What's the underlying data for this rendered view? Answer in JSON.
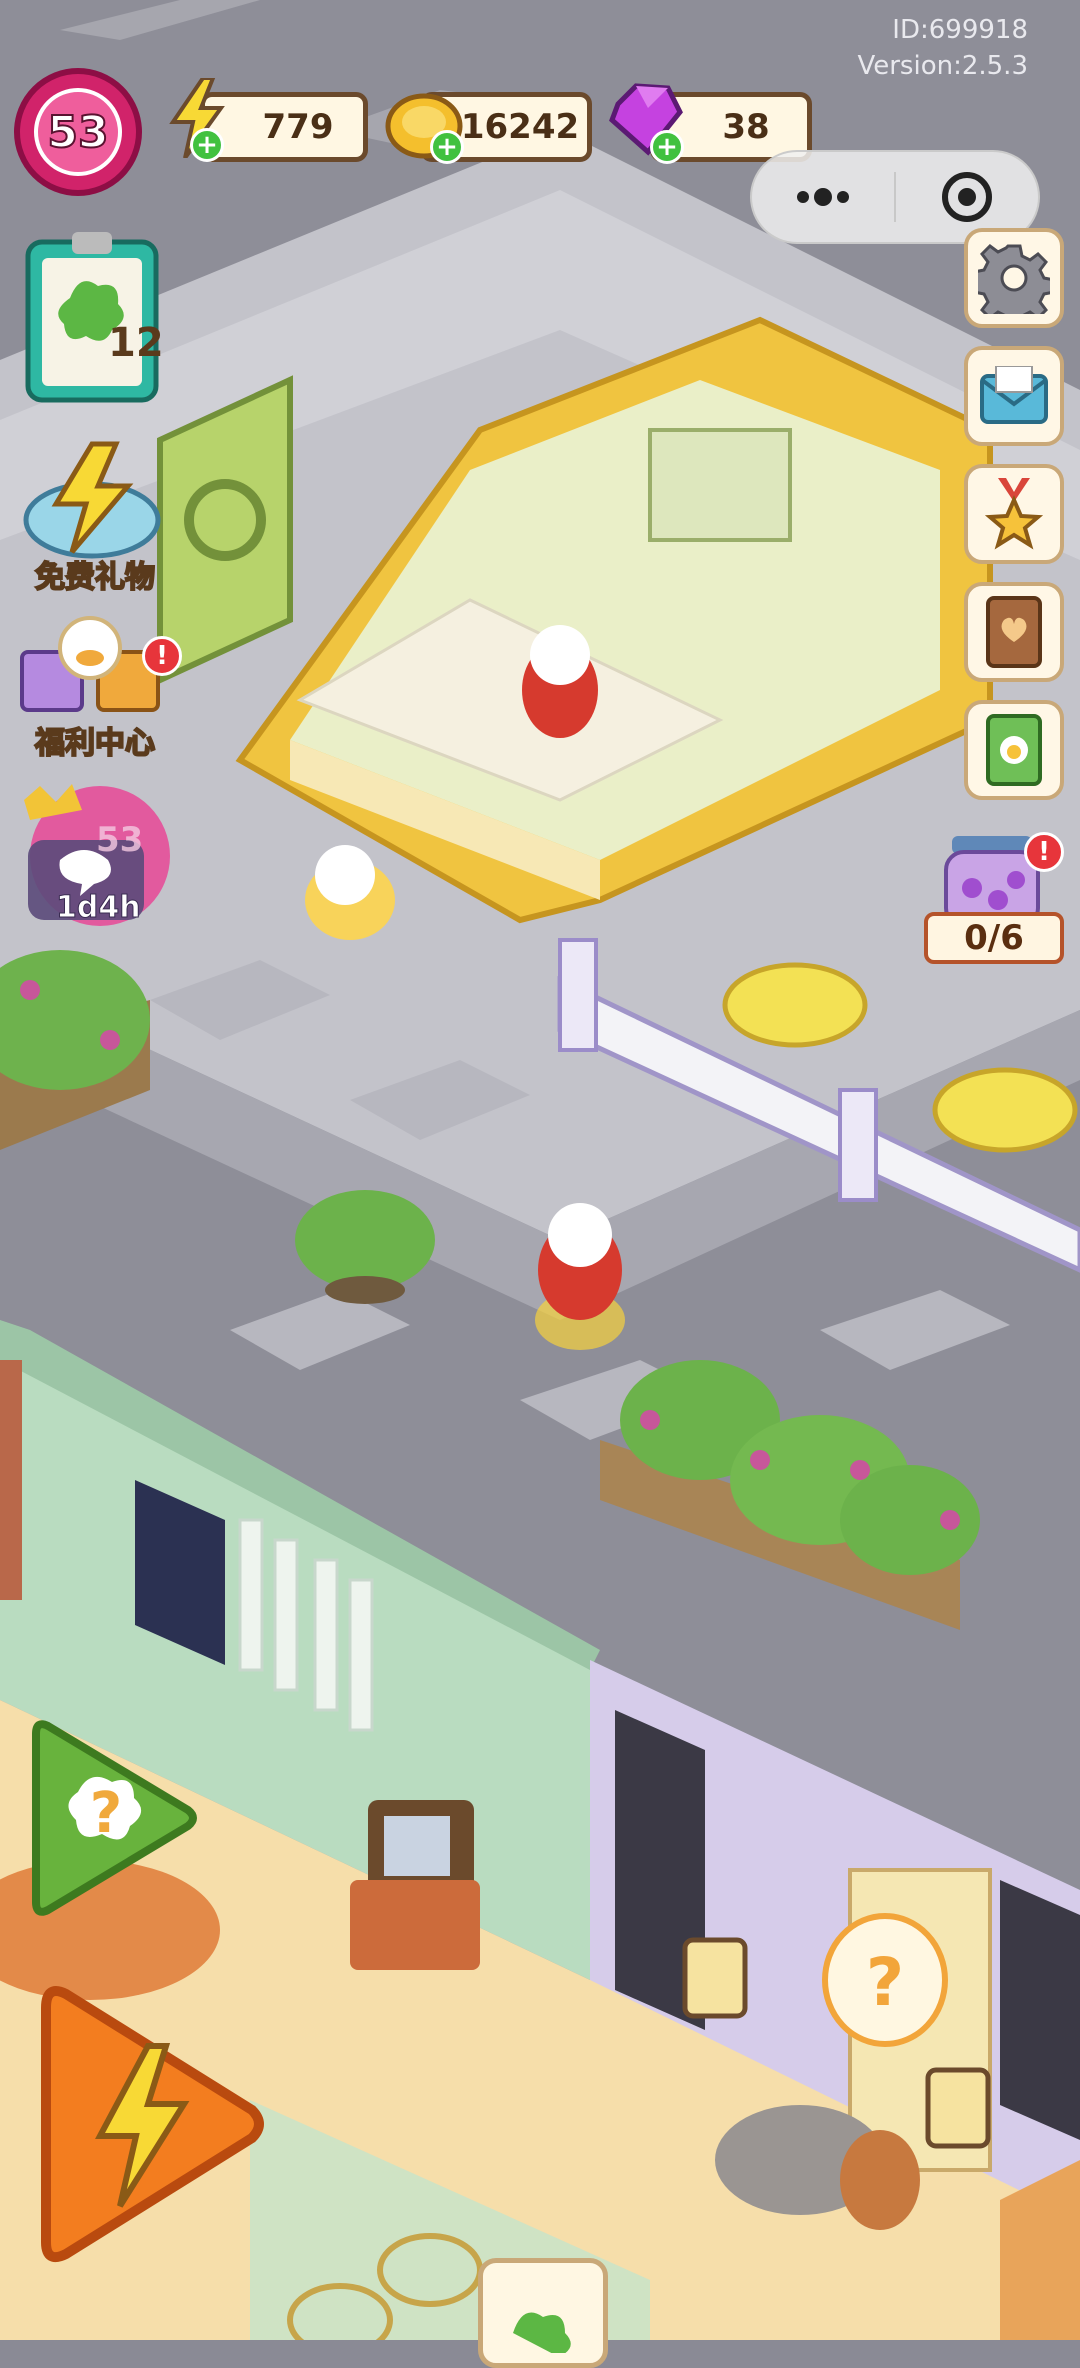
{
  "device": {
    "user_id": "ID:699918",
    "version": "Version:2.5.3"
  },
  "player": {
    "level": "53"
  },
  "resources": {
    "energy": {
      "value": "779",
      "icon": "lightning-icon"
    },
    "coins": {
      "value": "16242",
      "icon": "coin-icon"
    },
    "gems": {
      "value": "38",
      "icon": "gem-icon"
    }
  },
  "left_menu": {
    "clipboard_count": "12",
    "free_gift_label": "免费礼物",
    "welfare_label": "福利中心",
    "welfare_badge": "!",
    "event_timer": "1d4h",
    "event_level": "53"
  },
  "right_menu": [
    "settings-icon",
    "mail-icon",
    "medal-icon",
    "journal-icon",
    "recipe-book-icon"
  ],
  "jar": {
    "progress": "0/6",
    "badge": "!"
  },
  "bottom": {
    "hint_button_icon": "question-icon",
    "energy_button_icon": "lightning-icon",
    "thought_bubble": "?"
  },
  "colors": {
    "road": "#8a8a95",
    "sidewalk": "#c9c9cf",
    "shop_wall": "#b9dcc0",
    "shop_wall_right": "#d6ccea",
    "floor": "#f4dca4",
    "accent_pink": "#d1236a",
    "accent_gold": "#f2c437"
  }
}
